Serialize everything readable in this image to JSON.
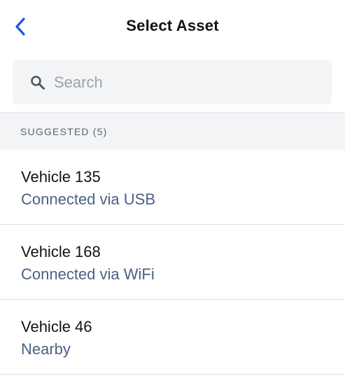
{
  "header": {
    "title": "Select Asset",
    "back_icon": "chevron-left-icon",
    "accent_color": "#1a56e8"
  },
  "search": {
    "placeholder": "Search",
    "value": "",
    "icon": "search-icon"
  },
  "section": {
    "label": "SUGGESTED (5)"
  },
  "assets": [
    {
      "name": "Vehicle 135",
      "status": "Connected via USB"
    },
    {
      "name": "Vehicle 168",
      "status": "Connected via WiFi"
    },
    {
      "name": "Vehicle 46",
      "status": "Nearby"
    }
  ]
}
